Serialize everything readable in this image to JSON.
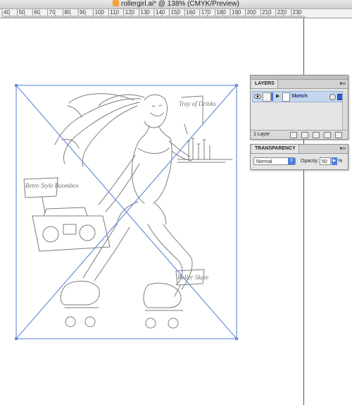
{
  "window": {
    "title": "rollergirl.ai* @ 138% (CMYK/Preview)"
  },
  "ruler": {
    "labels": [
      "40",
      "50",
      "60",
      "70",
      "80",
      "90",
      "100",
      "110",
      "120",
      "130",
      "140",
      "150",
      "160",
      "170",
      "180",
      "190",
      "200",
      "210",
      "220",
      "230"
    ]
  },
  "layers_panel": {
    "tab_label": "LAYERS",
    "layers": [
      {
        "name": "Sketch",
        "color": "#4a78d8"
      }
    ],
    "count_label": "1 Layer"
  },
  "transparency_panel": {
    "tab_label": "TRANSPARENCY",
    "blend_mode": "Normal",
    "opacity_label": "Opacity:",
    "opacity_value": "50",
    "opacity_unit": "%"
  },
  "sketch_notes": [
    "Tray of Drinks",
    "Retro Style Boombox",
    "Roller Skate"
  ],
  "colors": {
    "selection": "#6a8fdc",
    "layer_highlight": "#c5d6ef",
    "pasteboard_line": "#555555"
  }
}
